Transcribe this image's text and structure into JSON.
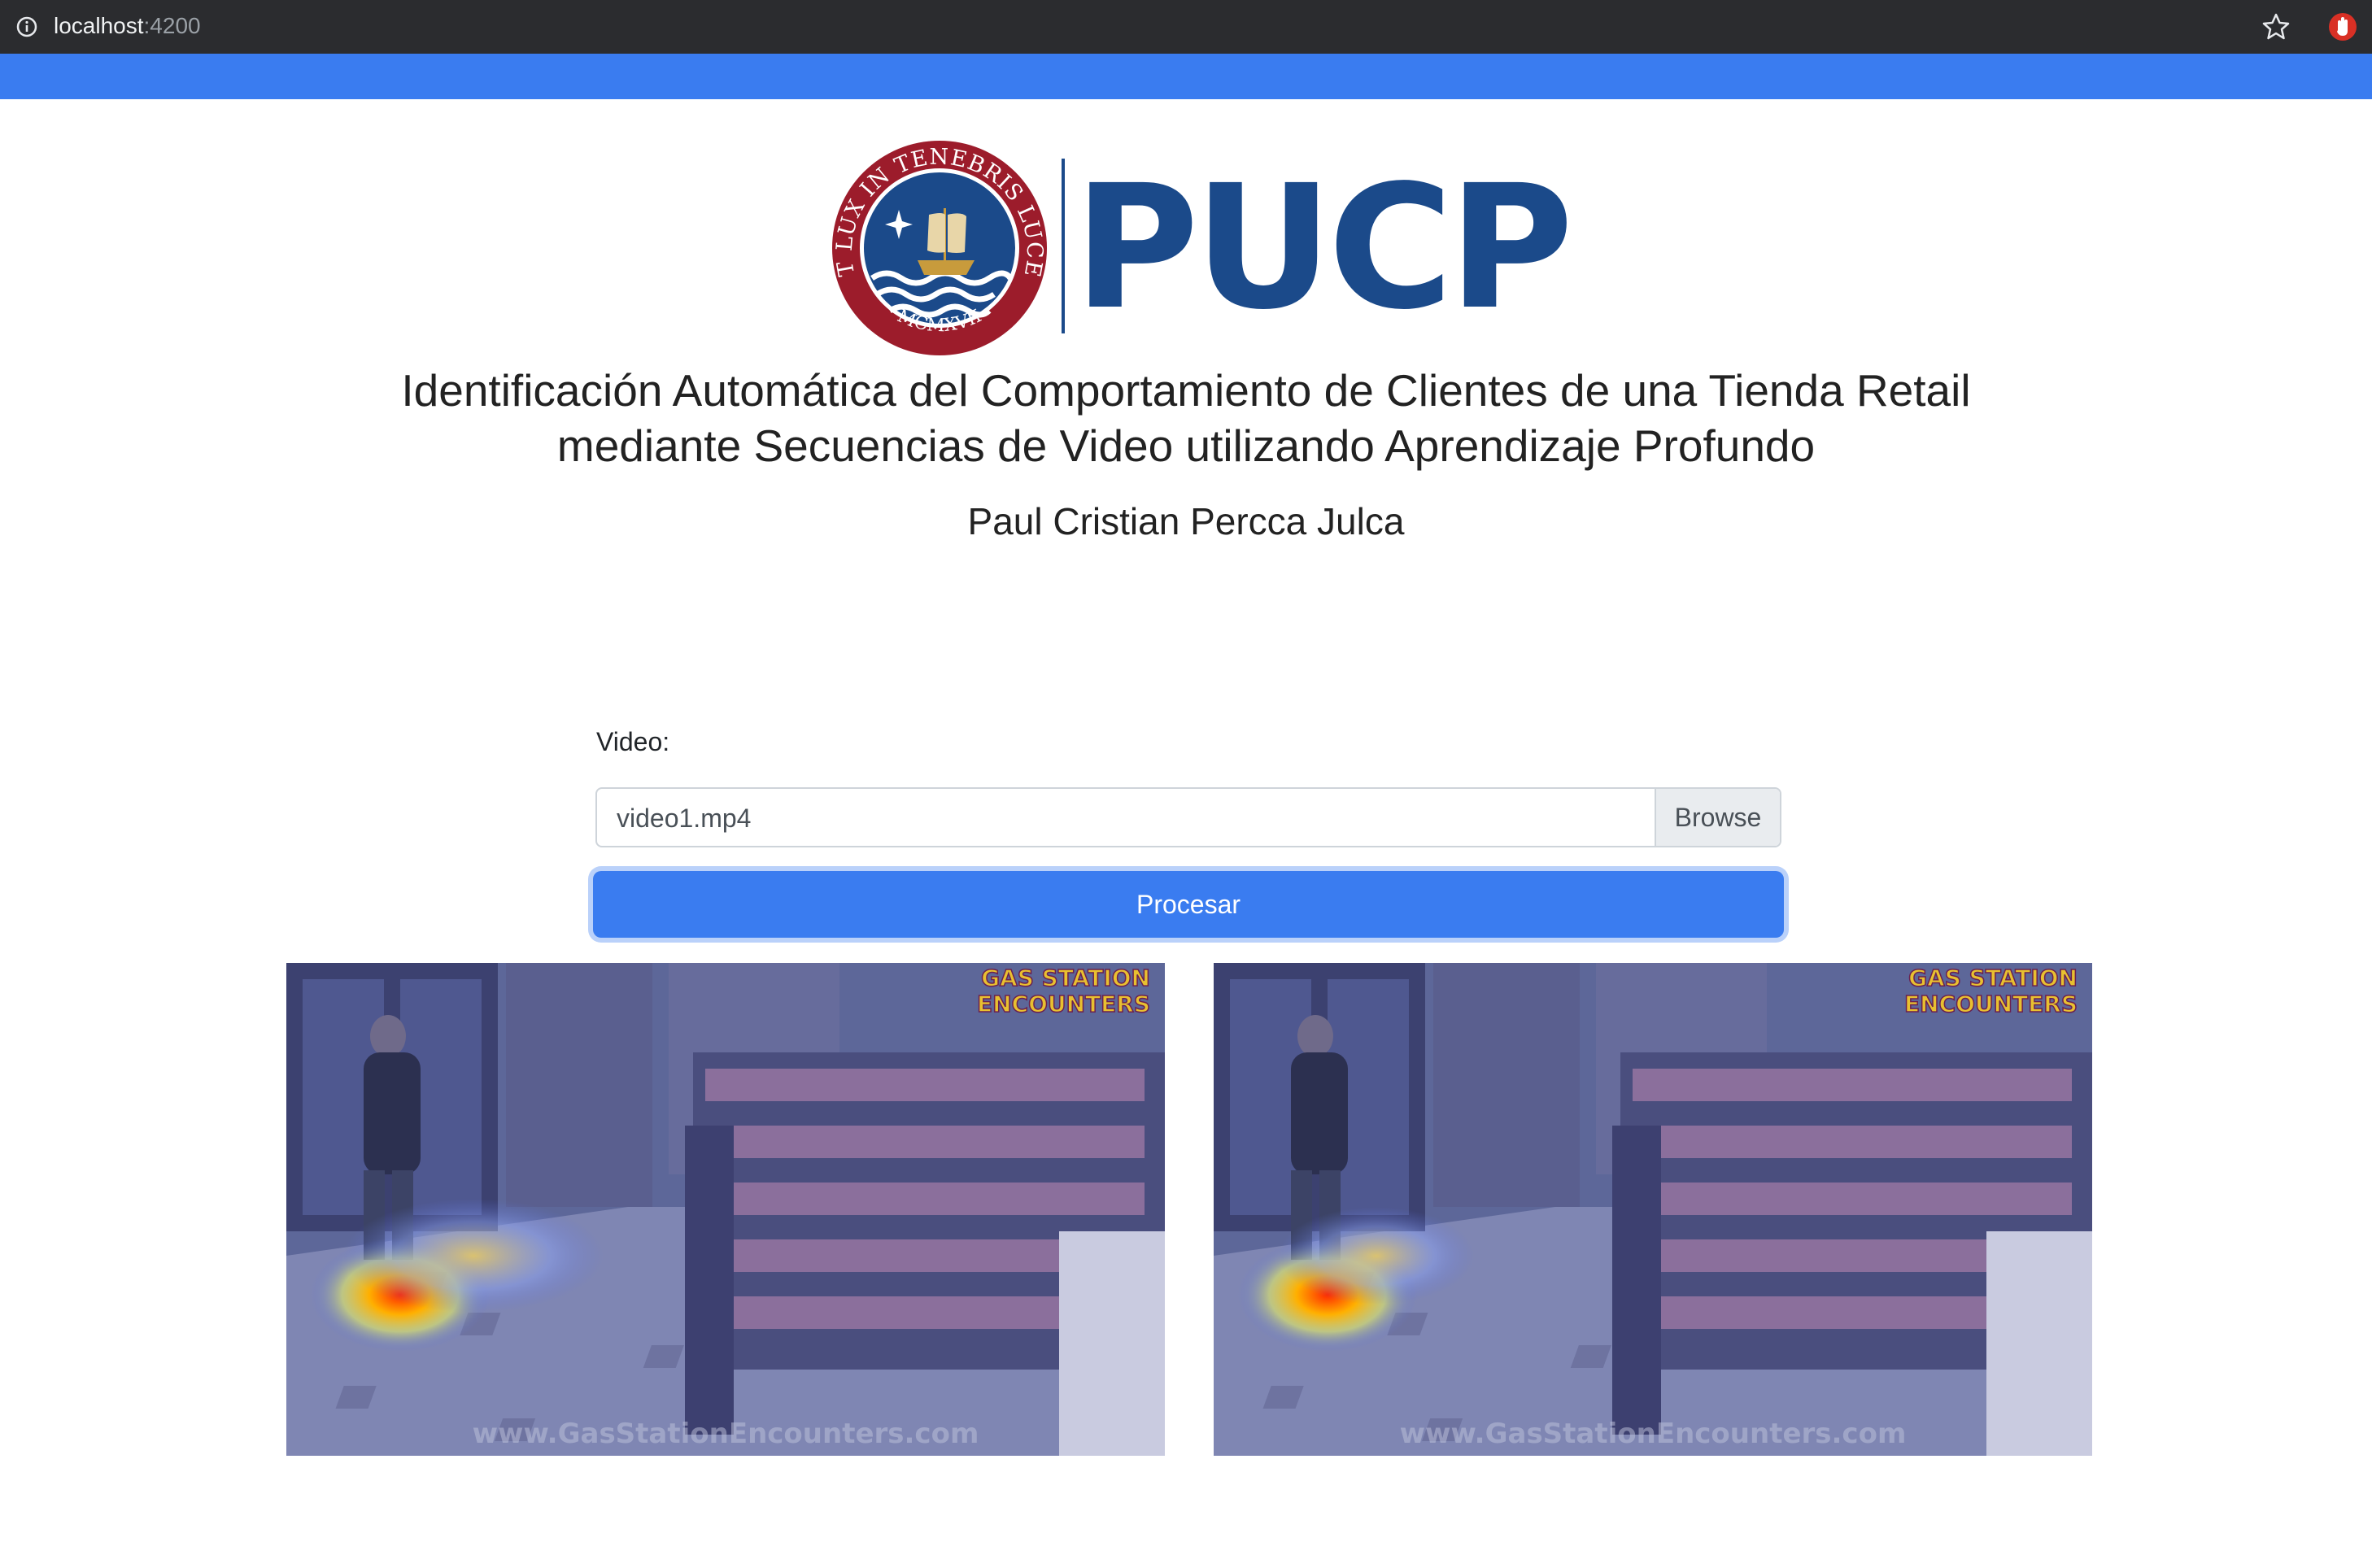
{
  "browser": {
    "url_host": "localhost",
    "url_port": ":4200",
    "icons": [
      "info-icon",
      "star-icon",
      "extension-icon"
    ]
  },
  "header": {
    "logo_text": "PUCP",
    "seal_motto": "ET LUX IN TENEBRIS LUCET",
    "seal_year": "MCMXVII",
    "title_line1": "Identificación Automática del Comportamiento de Clientes de una Tienda Retail",
    "title_line2": "mediante Secuencias de Video utilizando Aprendizaje Profundo",
    "author": "Paul Cristian Percca Julca"
  },
  "form": {
    "video_label": "Video:",
    "file_value": "video1.mp4",
    "browse_label": "Browse",
    "submit_label": "Procesar"
  },
  "results": {
    "frames": [
      {
        "watermark": "www.GasStationEncounters.com",
        "overlay_brand": "GAS STATION ENCOUNTERS"
      },
      {
        "watermark": "www.GasStationEncounters.com",
        "overlay_brand": "GAS STATION ENCOUNTERS"
      }
    ]
  },
  "colors": {
    "navbar": "#3a7cf0",
    "pucp_blue": "#1b4a8a",
    "seal_red": "#9c1c2b",
    "button_primary": "#3a7cf0"
  }
}
